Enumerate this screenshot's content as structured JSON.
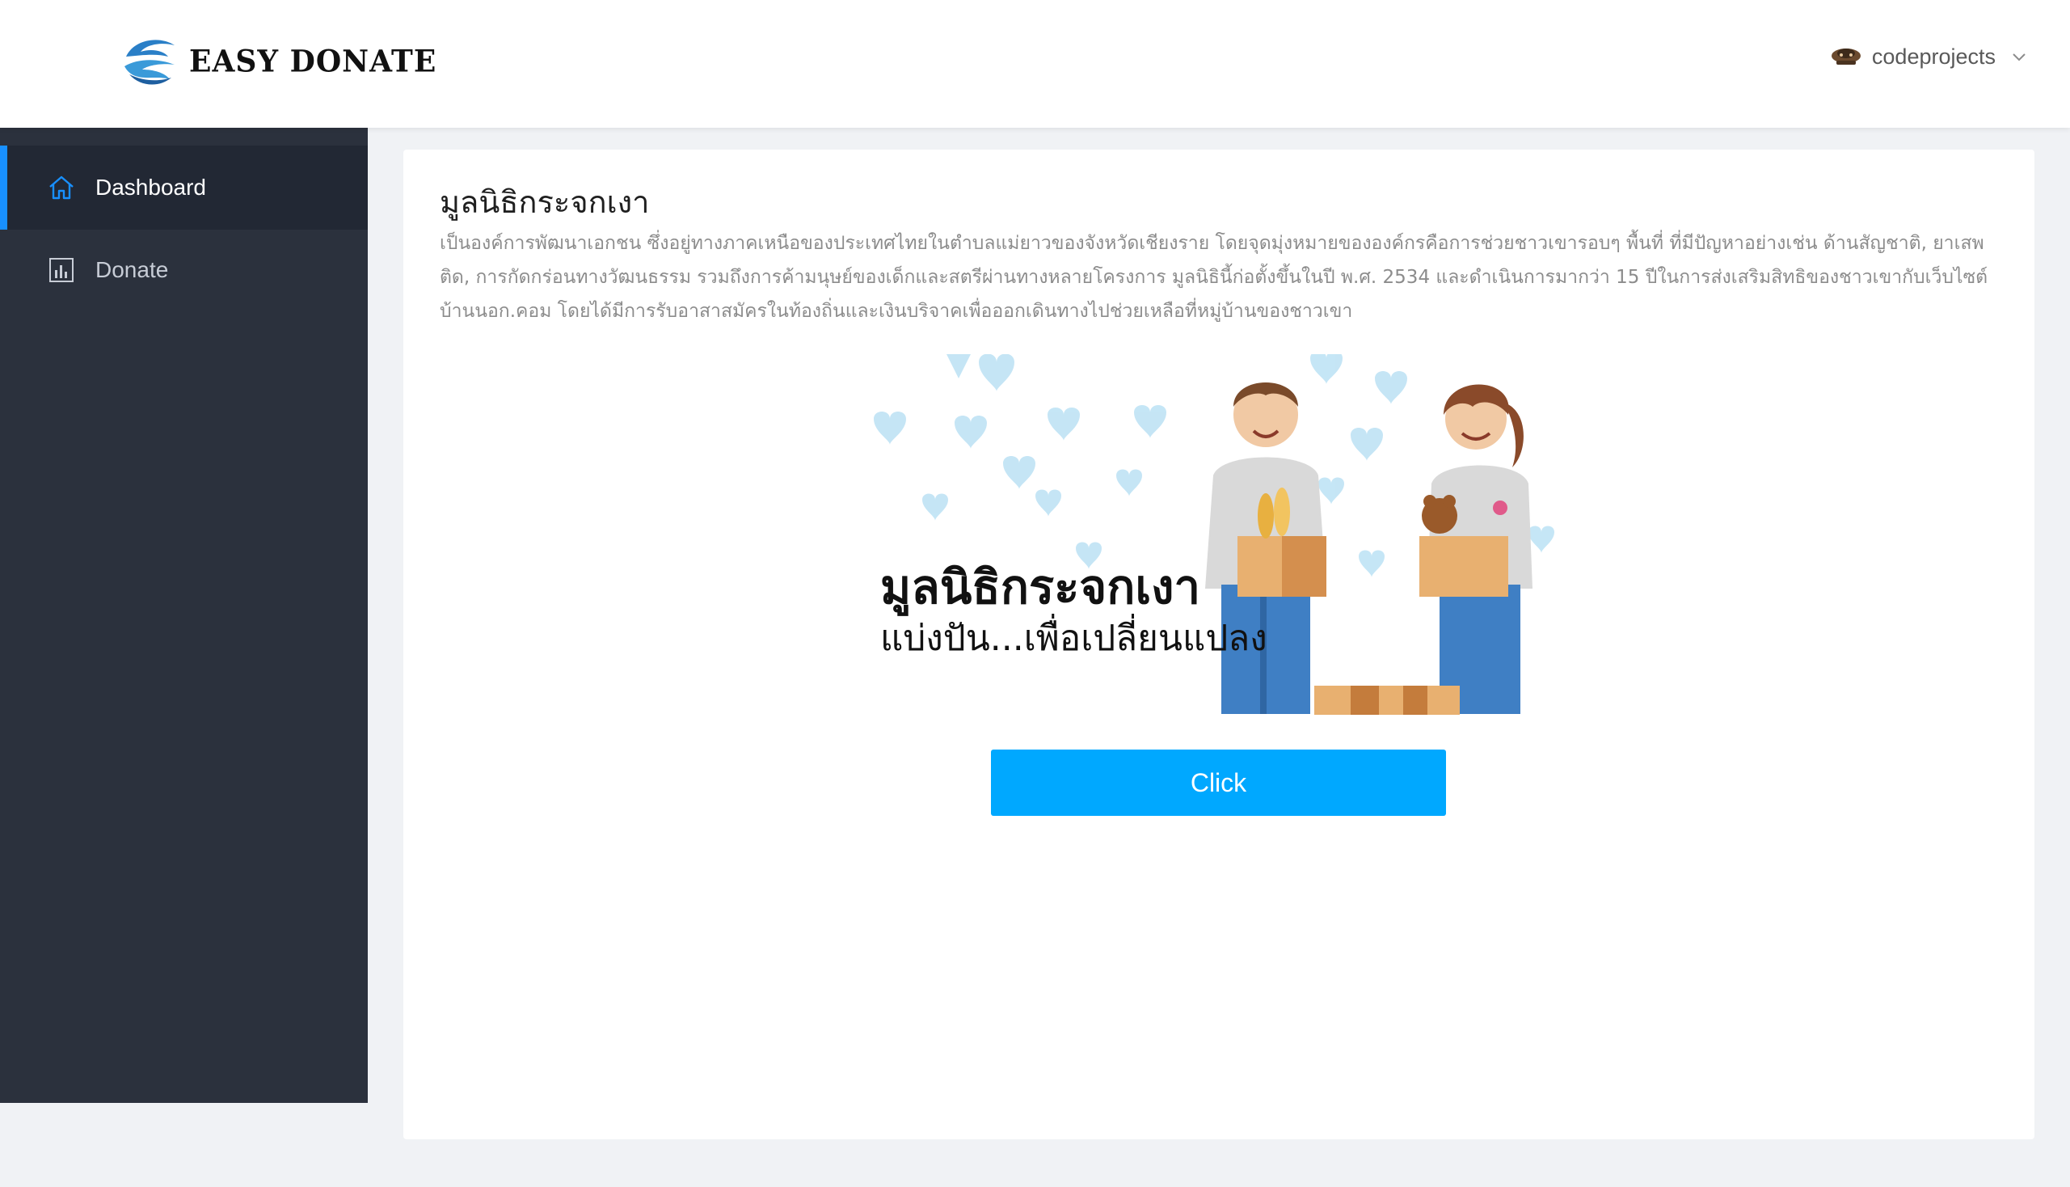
{
  "header": {
    "logo_text": "EASY DONATE",
    "user_name": "codeprojects"
  },
  "sidebar": {
    "items": [
      {
        "label": "Dashboard",
        "icon": "home-icon",
        "active": true
      },
      {
        "label": "Donate",
        "icon": "bar-chart-icon",
        "active": false
      }
    ]
  },
  "main": {
    "title": "มูลนิธิกระจกเงา",
    "description": "เป็นองค์การพัฒนาเอกชน ซึ่งอยู่ทางภาคเหนือของประเทศไทยในตำบลแม่ยาวของจังหวัดเชียงราย โดยจุดมุ่งหมายขององค์กรคือการช่วยชาวเขารอบๆ พื้นที่ ที่มีปัญหาอย่างเช่น ด้านสัญชาติ, ยาเสพติด, การกัดกร่อนทางวัฒนธรรม รวมถึงการค้ามนุษย์ของเด็กและสตรีผ่านทางหลายโครงการ มูลนิธินี้ก่อตั้งขึ้นในปี พ.ศ. 2534 และดำเนินการมากว่า 15 ปีในการส่งเสริมสิทธิของชาวเขากับเว็บไซต์ บ้านนอก.คอม โดยได้มีการรับอาสาสมัครในท้องถิ่นและเงินบริจาคเพื่อออกเดินทางไปช่วยเหลือที่หมู่บ้านของชาวเขา",
    "banner": {
      "title": "มูลนิธิกระจกเงา",
      "subtitle": "แบ่งปัน...เพื่อเปลี่ยนแปลง"
    },
    "button_label": "Click"
  },
  "colors": {
    "accent": "#1890ff",
    "button": "#00a8ff",
    "sidebar": "#2b313d",
    "sidebar_active": "#222834"
  }
}
